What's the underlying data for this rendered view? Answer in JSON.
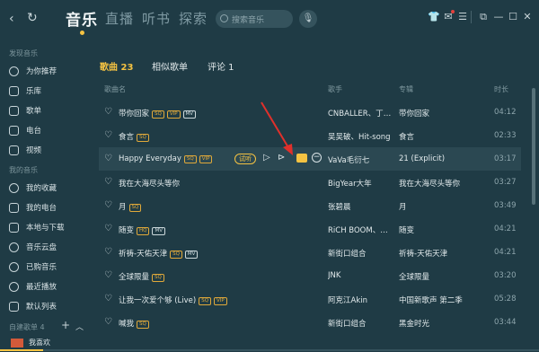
{
  "header": {
    "nav_tabs": [
      "音乐",
      "直播",
      "听书",
      "探索"
    ],
    "search_placeholder": "搜索音乐",
    "icons": [
      "back-icon",
      "refresh-icon",
      "search-icon",
      "mic-icon",
      "skin-icon",
      "mail-icon",
      "menu-icon",
      "mini-mode-icon",
      "minimize-icon",
      "maximize-icon",
      "close-icon"
    ]
  },
  "sidebar": {
    "group1": "发现音乐",
    "items1": [
      "为你推荐",
      "乐库",
      "歌单",
      "电台",
      "视频"
    ],
    "group2": "我的音乐",
    "items2": [
      "我的收藏",
      "我的电台",
      "本地与下载",
      "音乐云盘",
      "已购音乐",
      "最近播放",
      "默认列表"
    ],
    "group3": "自建歌单 4",
    "bottom_item": "我喜欢"
  },
  "content_tabs": [
    "歌曲 23",
    "相似歌单",
    "评论 1"
  ],
  "table": {
    "headers": {
      "song": "歌曲名",
      "artist": "歌手",
      "album": "专辑",
      "time": "时长"
    },
    "rows": [
      {
        "title": "带你回家",
        "badges": [
          "SQ",
          "VIP",
          "MV"
        ],
        "artist": "CNBALLER、丁世...",
        "album": "带你回家",
        "time": "04:12"
      },
      {
        "title": "食言",
        "badges": [
          "SQ"
        ],
        "artist": "吴吴破、Hit-song",
        "album": "食言",
        "time": "02:33"
      },
      {
        "title": "Happy Everyday",
        "badges": [
          "SQ",
          "VIP"
        ],
        "artist": "VaVa毛衍七",
        "album": "21 (Explicit)",
        "time": "03:17",
        "trial": "试听"
      },
      {
        "title": "我在大海尽头等你",
        "badges": [],
        "artist": "BigYear大年",
        "album": "我在大海尽头等你",
        "time": "03:27"
      },
      {
        "title": "月",
        "badges": [
          "SQ"
        ],
        "artist": "张碧晨",
        "album": "月",
        "time": "03:49"
      },
      {
        "title": "随变",
        "badges": [
          "HQ",
          "MV"
        ],
        "artist": "RiCH BOOM、布...",
        "album": "随变",
        "time": "04:21"
      },
      {
        "title": "祈祷-天佑天津",
        "badges": [
          "SQ",
          "MV"
        ],
        "artist": "新街口组合",
        "album": "祈祷-天佑天津",
        "time": "04:21"
      },
      {
        "title": "全球限量",
        "badges": [
          "SQ"
        ],
        "artist": "JNK",
        "album": "全球限量",
        "time": "03:20"
      },
      {
        "title": "让我一次爱个够 (Live)",
        "badges": [
          "SQ",
          "VIP"
        ],
        "artist": "阿克江Akin",
        "album": "中国新歌声 第二季",
        "time": "05:28"
      },
      {
        "title": "喊我",
        "badges": [
          "SQ"
        ],
        "artist": "新街口组合",
        "album": "黑金时光",
        "time": "03:44"
      }
    ]
  },
  "progress": 0.08,
  "colors": {
    "accent": "#f5c342",
    "bg": "#1f3b45",
    "highlight": "#2b4852",
    "annotation": "#e0302b"
  }
}
